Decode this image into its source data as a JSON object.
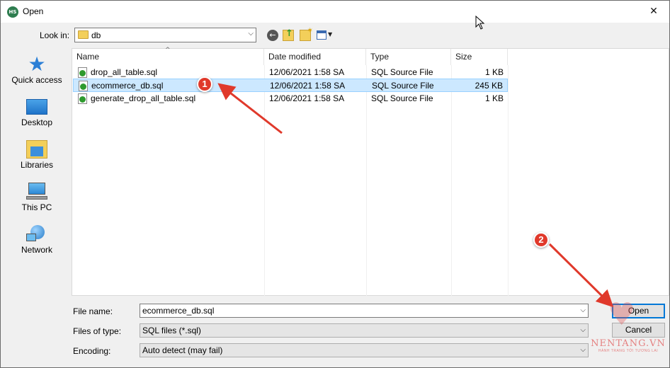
{
  "window": {
    "title": "Open",
    "app_icon_text": "HS",
    "close_glyph": "✕"
  },
  "toolbar": {
    "look_in_label": "Look in:",
    "look_in_value": "db",
    "icons": [
      "back-icon",
      "up-folder-icon",
      "new-folder-icon",
      "view-menu-icon"
    ]
  },
  "places": [
    {
      "label": "Quick access",
      "icon": "star-icon"
    },
    {
      "label": "Desktop",
      "icon": "desktop-icon"
    },
    {
      "label": "Libraries",
      "icon": "libraries-icon"
    },
    {
      "label": "This PC",
      "icon": "computer-icon"
    },
    {
      "label": "Network",
      "icon": "network-icon"
    }
  ],
  "filelist": {
    "columns": {
      "name": "Name",
      "date": "Date modified",
      "type": "Type",
      "size": "Size"
    },
    "sort_arrow": "^",
    "rows": [
      {
        "name": "drop_all_table.sql",
        "date": "12/06/2021 1:58 SA",
        "type": "SQL Source File",
        "size": "1 KB",
        "selected": false
      },
      {
        "name": "ecommerce_db.sql",
        "date": "12/06/2021 1:58 SA",
        "type": "SQL Source File",
        "size": "245 KB",
        "selected": true
      },
      {
        "name": "generate_drop_all_table.sql",
        "date": "12/06/2021 1:58 SA",
        "type": "SQL Source File",
        "size": "1 KB",
        "selected": false
      }
    ]
  },
  "form": {
    "file_name_label": "File name:",
    "file_name_value": "ecommerce_db.sql",
    "files_of_type_label": "Files of type:",
    "files_of_type_value": "SQL files (*.sql)",
    "encoding_label": "Encoding:",
    "encoding_value": "Auto detect (may fail)"
  },
  "buttons": {
    "open": "Open",
    "cancel": "Cancel"
  },
  "annotations": {
    "callout_1": "1",
    "callout_2": "2",
    "arrow_color": "#e0392b"
  },
  "watermark": {
    "main": "NENTANG.VN",
    "sub": "HÀNH TRANG TỚI TƯƠNG LAI"
  },
  "colors": {
    "selection": "#cce8ff",
    "accent": "#0078d7"
  }
}
